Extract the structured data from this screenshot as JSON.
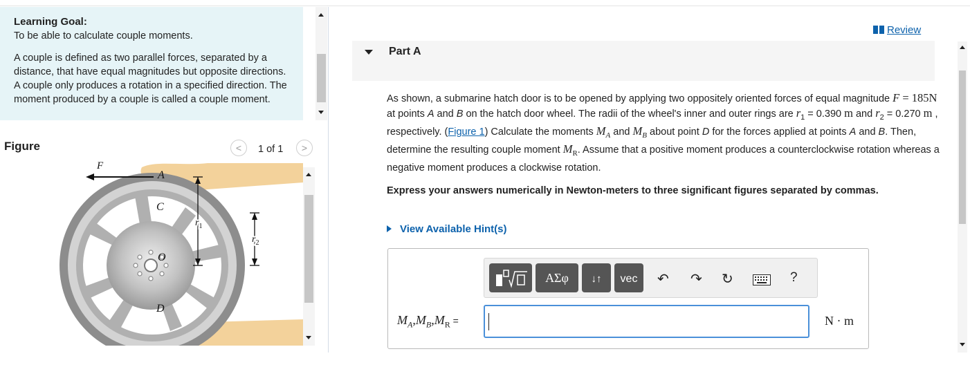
{
  "goal": {
    "title": "Learning Goal:",
    "subtitle": "To be able to calculate couple moments.",
    "body": "A couple is defined as two parallel forces, separated by a distance, that have equal magnitudes but opposite directions. A couple only produces a rotation in a specified direction. The moment produced by a couple is called a couple moment."
  },
  "figure": {
    "label": "Figure",
    "page": "1 of 1",
    "prev_icon": "chevron-left-icon",
    "next_icon": "chevron-right-icon",
    "labels": {
      "A": "A",
      "C": "C",
      "O": "O",
      "D": "D",
      "r1": "r",
      "r1_sub": "1",
      "r2": "r",
      "r2_sub": "2",
      "F": "F"
    }
  },
  "review": {
    "label": "Review",
    "icon": "book-icon"
  },
  "part": {
    "title": "Part A"
  },
  "problem": {
    "t1": "As shown, a submarine hatch door is to be opened by applying two oppositely oriented forces of equal magnitude ",
    "F": "F",
    "eq": " = ",
    "Fval": "185N",
    "t2": " at points ",
    "A": "A",
    "t3": " and ",
    "B": "B",
    "t4": " on the hatch door wheel. The radii of the wheel's inner and outer rings are ",
    "r1": "r",
    "r1sub": "1",
    "r1val": " = 0.390 ",
    "munit": "m",
    "t5": " and ",
    "r2": "r",
    "r2sub": "2",
    "r2val": " = 0.270 ",
    "munit2": "m",
    "t6": " , respectively. (",
    "fig_link": "Figure 1",
    "t7": ") Calculate the moments ",
    "MA": "M",
    "MAsub": "A",
    "t8": " and ",
    "MB": "M",
    "MBsub": "B",
    "t9": " about point ",
    "D": "D",
    "t10": " for the forces applied at points ",
    "A2": "A",
    "t11": " and ",
    "B2": "B",
    "t12": ". Then, determine the resulting couple moment ",
    "MR": "M",
    "MRsub": "R",
    "t13": ". Assume that a positive moment produces a counterclockwise rotation whereas a negative moment produces a clockwise rotation."
  },
  "express": "Express your answers numerically in Newton-meters to three significant figures separated by commas.",
  "hint": "View Available Hint(s)",
  "toolbar": {
    "templates_icon": "templates-icon",
    "greek_label": "ΑΣφ",
    "arrows_label": "↓↑",
    "vec_label": "vec",
    "undo_icon": "undo-icon",
    "redo_icon": "redo-icon",
    "reset_icon": "reset-icon",
    "keyboard_icon": "keyboard-icon",
    "help_label": "?"
  },
  "answer": {
    "lhs": "MA,MB,MR =",
    "M": "M",
    "subA": "A",
    "subB": "B",
    "subR": "R",
    "comma": ",",
    "eqsign": " =",
    "value": "",
    "units_N": "N",
    "units_dot": " · ",
    "units_m": "m"
  }
}
